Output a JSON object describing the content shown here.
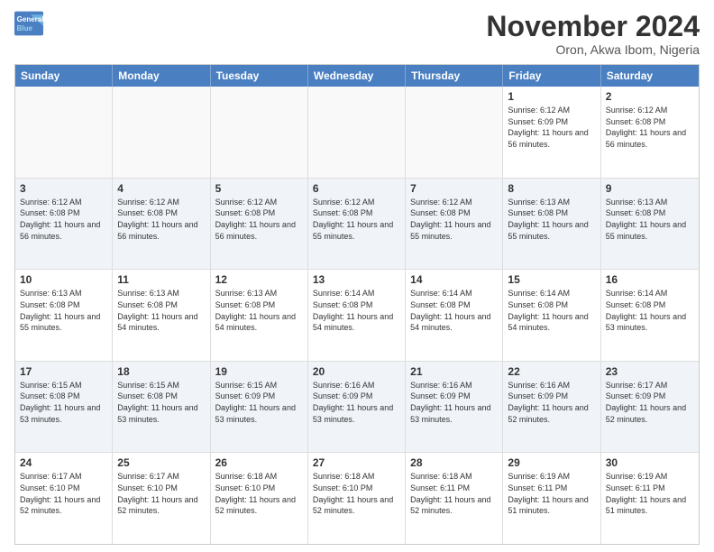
{
  "header": {
    "logo_line1": "General",
    "logo_line2": "Blue",
    "month": "November 2024",
    "location": "Oron, Akwa Ibom, Nigeria"
  },
  "weekdays": [
    "Sunday",
    "Monday",
    "Tuesday",
    "Wednesday",
    "Thursday",
    "Friday",
    "Saturday"
  ],
  "rows": [
    [
      {
        "day": "",
        "info": "",
        "empty": true
      },
      {
        "day": "",
        "info": "",
        "empty": true
      },
      {
        "day": "",
        "info": "",
        "empty": true
      },
      {
        "day": "",
        "info": "",
        "empty": true
      },
      {
        "day": "",
        "info": "",
        "empty": true
      },
      {
        "day": "1",
        "info": "Sunrise: 6:12 AM\nSunset: 6:09 PM\nDaylight: 11 hours and 56 minutes.",
        "empty": false
      },
      {
        "day": "2",
        "info": "Sunrise: 6:12 AM\nSunset: 6:08 PM\nDaylight: 11 hours and 56 minutes.",
        "empty": false
      }
    ],
    [
      {
        "day": "3",
        "info": "Sunrise: 6:12 AM\nSunset: 6:08 PM\nDaylight: 11 hours and 56 minutes.",
        "empty": false
      },
      {
        "day": "4",
        "info": "Sunrise: 6:12 AM\nSunset: 6:08 PM\nDaylight: 11 hours and 56 minutes.",
        "empty": false
      },
      {
        "day": "5",
        "info": "Sunrise: 6:12 AM\nSunset: 6:08 PM\nDaylight: 11 hours and 56 minutes.",
        "empty": false
      },
      {
        "day": "6",
        "info": "Sunrise: 6:12 AM\nSunset: 6:08 PM\nDaylight: 11 hours and 55 minutes.",
        "empty": false
      },
      {
        "day": "7",
        "info": "Sunrise: 6:12 AM\nSunset: 6:08 PM\nDaylight: 11 hours and 55 minutes.",
        "empty": false
      },
      {
        "day": "8",
        "info": "Sunrise: 6:13 AM\nSunset: 6:08 PM\nDaylight: 11 hours and 55 minutes.",
        "empty": false
      },
      {
        "day": "9",
        "info": "Sunrise: 6:13 AM\nSunset: 6:08 PM\nDaylight: 11 hours and 55 minutes.",
        "empty": false
      }
    ],
    [
      {
        "day": "10",
        "info": "Sunrise: 6:13 AM\nSunset: 6:08 PM\nDaylight: 11 hours and 55 minutes.",
        "empty": false
      },
      {
        "day": "11",
        "info": "Sunrise: 6:13 AM\nSunset: 6:08 PM\nDaylight: 11 hours and 54 minutes.",
        "empty": false
      },
      {
        "day": "12",
        "info": "Sunrise: 6:13 AM\nSunset: 6:08 PM\nDaylight: 11 hours and 54 minutes.",
        "empty": false
      },
      {
        "day": "13",
        "info": "Sunrise: 6:14 AM\nSunset: 6:08 PM\nDaylight: 11 hours and 54 minutes.",
        "empty": false
      },
      {
        "day": "14",
        "info": "Sunrise: 6:14 AM\nSunset: 6:08 PM\nDaylight: 11 hours and 54 minutes.",
        "empty": false
      },
      {
        "day": "15",
        "info": "Sunrise: 6:14 AM\nSunset: 6:08 PM\nDaylight: 11 hours and 54 minutes.",
        "empty": false
      },
      {
        "day": "16",
        "info": "Sunrise: 6:14 AM\nSunset: 6:08 PM\nDaylight: 11 hours and 53 minutes.",
        "empty": false
      }
    ],
    [
      {
        "day": "17",
        "info": "Sunrise: 6:15 AM\nSunset: 6:08 PM\nDaylight: 11 hours and 53 minutes.",
        "empty": false
      },
      {
        "day": "18",
        "info": "Sunrise: 6:15 AM\nSunset: 6:08 PM\nDaylight: 11 hours and 53 minutes.",
        "empty": false
      },
      {
        "day": "19",
        "info": "Sunrise: 6:15 AM\nSunset: 6:09 PM\nDaylight: 11 hours and 53 minutes.",
        "empty": false
      },
      {
        "day": "20",
        "info": "Sunrise: 6:16 AM\nSunset: 6:09 PM\nDaylight: 11 hours and 53 minutes.",
        "empty": false
      },
      {
        "day": "21",
        "info": "Sunrise: 6:16 AM\nSunset: 6:09 PM\nDaylight: 11 hours and 53 minutes.",
        "empty": false
      },
      {
        "day": "22",
        "info": "Sunrise: 6:16 AM\nSunset: 6:09 PM\nDaylight: 11 hours and 52 minutes.",
        "empty": false
      },
      {
        "day": "23",
        "info": "Sunrise: 6:17 AM\nSunset: 6:09 PM\nDaylight: 11 hours and 52 minutes.",
        "empty": false
      }
    ],
    [
      {
        "day": "24",
        "info": "Sunrise: 6:17 AM\nSunset: 6:10 PM\nDaylight: 11 hours and 52 minutes.",
        "empty": false
      },
      {
        "day": "25",
        "info": "Sunrise: 6:17 AM\nSunset: 6:10 PM\nDaylight: 11 hours and 52 minutes.",
        "empty": false
      },
      {
        "day": "26",
        "info": "Sunrise: 6:18 AM\nSunset: 6:10 PM\nDaylight: 11 hours and 52 minutes.",
        "empty": false
      },
      {
        "day": "27",
        "info": "Sunrise: 6:18 AM\nSunset: 6:10 PM\nDaylight: 11 hours and 52 minutes.",
        "empty": false
      },
      {
        "day": "28",
        "info": "Sunrise: 6:18 AM\nSunset: 6:11 PM\nDaylight: 11 hours and 52 minutes.",
        "empty": false
      },
      {
        "day": "29",
        "info": "Sunrise: 6:19 AM\nSunset: 6:11 PM\nDaylight: 11 hours and 51 minutes.",
        "empty": false
      },
      {
        "day": "30",
        "info": "Sunrise: 6:19 AM\nSunset: 6:11 PM\nDaylight: 11 hours and 51 minutes.",
        "empty": false
      }
    ]
  ]
}
